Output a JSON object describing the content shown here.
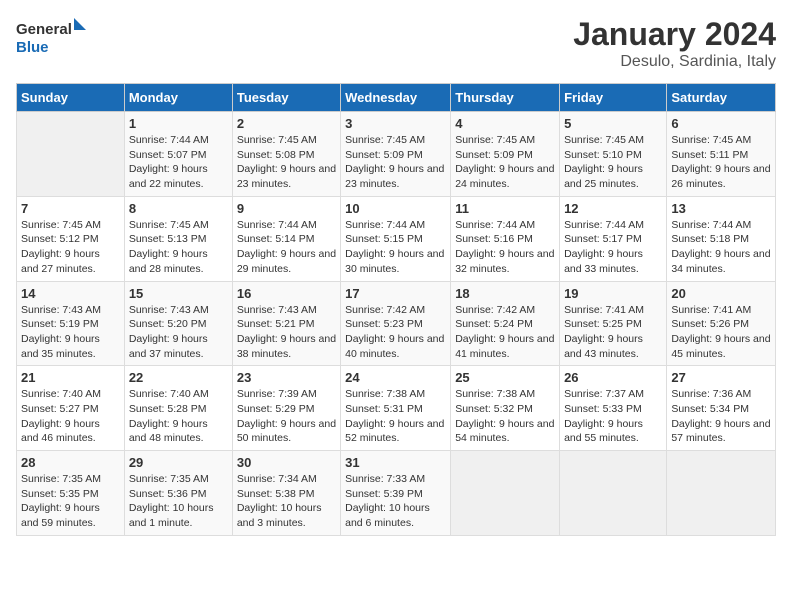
{
  "logo": {
    "general": "General",
    "blue": "Blue"
  },
  "title": "January 2024",
  "subtitle": "Desulo, Sardinia, Italy",
  "days_of_week": [
    "Sunday",
    "Monday",
    "Tuesday",
    "Wednesday",
    "Thursday",
    "Friday",
    "Saturday"
  ],
  "weeks": [
    [
      {
        "day": "",
        "info": ""
      },
      {
        "day": "1",
        "info": "Sunrise: 7:44 AM\nSunset: 5:07 PM\nDaylight: 9 hours and 22 minutes."
      },
      {
        "day": "2",
        "info": "Sunrise: 7:45 AM\nSunset: 5:08 PM\nDaylight: 9 hours and 23 minutes."
      },
      {
        "day": "3",
        "info": "Sunrise: 7:45 AM\nSunset: 5:09 PM\nDaylight: 9 hours and 23 minutes."
      },
      {
        "day": "4",
        "info": "Sunrise: 7:45 AM\nSunset: 5:09 PM\nDaylight: 9 hours and 24 minutes."
      },
      {
        "day": "5",
        "info": "Sunrise: 7:45 AM\nSunset: 5:10 PM\nDaylight: 9 hours and 25 minutes."
      },
      {
        "day": "6",
        "info": "Sunrise: 7:45 AM\nSunset: 5:11 PM\nDaylight: 9 hours and 26 minutes."
      }
    ],
    [
      {
        "day": "7",
        "info": "Sunrise: 7:45 AM\nSunset: 5:12 PM\nDaylight: 9 hours and 27 minutes."
      },
      {
        "day": "8",
        "info": "Sunrise: 7:45 AM\nSunset: 5:13 PM\nDaylight: 9 hours and 28 minutes."
      },
      {
        "day": "9",
        "info": "Sunrise: 7:44 AM\nSunset: 5:14 PM\nDaylight: 9 hours and 29 minutes."
      },
      {
        "day": "10",
        "info": "Sunrise: 7:44 AM\nSunset: 5:15 PM\nDaylight: 9 hours and 30 minutes."
      },
      {
        "day": "11",
        "info": "Sunrise: 7:44 AM\nSunset: 5:16 PM\nDaylight: 9 hours and 32 minutes."
      },
      {
        "day": "12",
        "info": "Sunrise: 7:44 AM\nSunset: 5:17 PM\nDaylight: 9 hours and 33 minutes."
      },
      {
        "day": "13",
        "info": "Sunrise: 7:44 AM\nSunset: 5:18 PM\nDaylight: 9 hours and 34 minutes."
      }
    ],
    [
      {
        "day": "14",
        "info": "Sunrise: 7:43 AM\nSunset: 5:19 PM\nDaylight: 9 hours and 35 minutes."
      },
      {
        "day": "15",
        "info": "Sunrise: 7:43 AM\nSunset: 5:20 PM\nDaylight: 9 hours and 37 minutes."
      },
      {
        "day": "16",
        "info": "Sunrise: 7:43 AM\nSunset: 5:21 PM\nDaylight: 9 hours and 38 minutes."
      },
      {
        "day": "17",
        "info": "Sunrise: 7:42 AM\nSunset: 5:23 PM\nDaylight: 9 hours and 40 minutes."
      },
      {
        "day": "18",
        "info": "Sunrise: 7:42 AM\nSunset: 5:24 PM\nDaylight: 9 hours and 41 minutes."
      },
      {
        "day": "19",
        "info": "Sunrise: 7:41 AM\nSunset: 5:25 PM\nDaylight: 9 hours and 43 minutes."
      },
      {
        "day": "20",
        "info": "Sunrise: 7:41 AM\nSunset: 5:26 PM\nDaylight: 9 hours and 45 minutes."
      }
    ],
    [
      {
        "day": "21",
        "info": "Sunrise: 7:40 AM\nSunset: 5:27 PM\nDaylight: 9 hours and 46 minutes."
      },
      {
        "day": "22",
        "info": "Sunrise: 7:40 AM\nSunset: 5:28 PM\nDaylight: 9 hours and 48 minutes."
      },
      {
        "day": "23",
        "info": "Sunrise: 7:39 AM\nSunset: 5:29 PM\nDaylight: 9 hours and 50 minutes."
      },
      {
        "day": "24",
        "info": "Sunrise: 7:38 AM\nSunset: 5:31 PM\nDaylight: 9 hours and 52 minutes."
      },
      {
        "day": "25",
        "info": "Sunrise: 7:38 AM\nSunset: 5:32 PM\nDaylight: 9 hours and 54 minutes."
      },
      {
        "day": "26",
        "info": "Sunrise: 7:37 AM\nSunset: 5:33 PM\nDaylight: 9 hours and 55 minutes."
      },
      {
        "day": "27",
        "info": "Sunrise: 7:36 AM\nSunset: 5:34 PM\nDaylight: 9 hours and 57 minutes."
      }
    ],
    [
      {
        "day": "28",
        "info": "Sunrise: 7:35 AM\nSunset: 5:35 PM\nDaylight: 9 hours and 59 minutes."
      },
      {
        "day": "29",
        "info": "Sunrise: 7:35 AM\nSunset: 5:36 PM\nDaylight: 10 hours and 1 minute."
      },
      {
        "day": "30",
        "info": "Sunrise: 7:34 AM\nSunset: 5:38 PM\nDaylight: 10 hours and 3 minutes."
      },
      {
        "day": "31",
        "info": "Sunrise: 7:33 AM\nSunset: 5:39 PM\nDaylight: 10 hours and 6 minutes."
      },
      {
        "day": "",
        "info": ""
      },
      {
        "day": "",
        "info": ""
      },
      {
        "day": "",
        "info": ""
      }
    ]
  ]
}
